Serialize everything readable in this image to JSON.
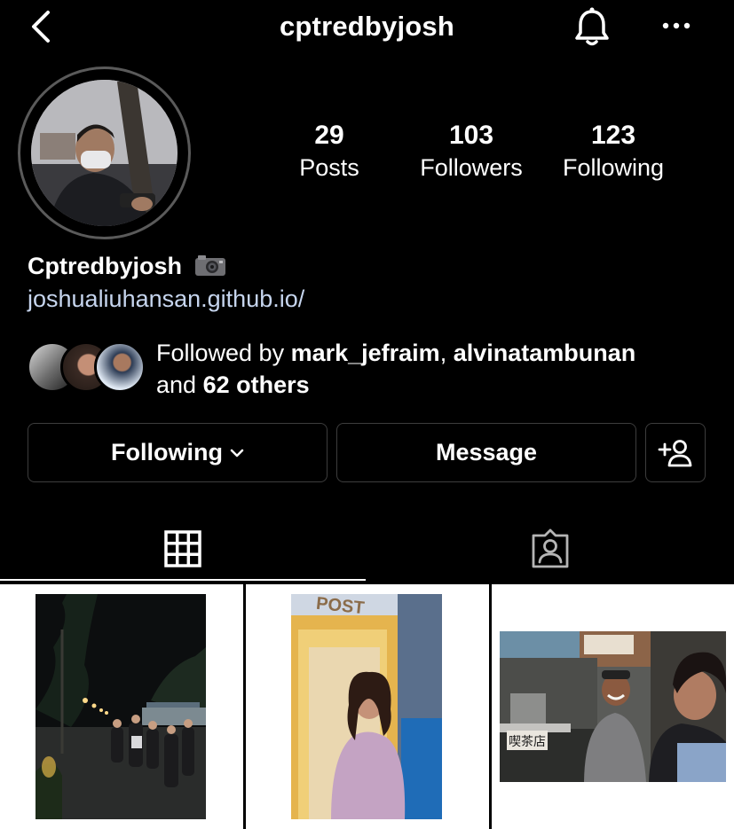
{
  "header": {
    "username": "cptredbyjosh",
    "back_icon": "chevron-left-icon",
    "bell_icon": "bell-icon",
    "more_icon": "more-horizontal-icon"
  },
  "profile": {
    "stats": [
      {
        "value": "29",
        "label": "Posts"
      },
      {
        "value": "103",
        "label": "Followers"
      },
      {
        "value": "123",
        "label": "Following"
      }
    ],
    "display_name": "Cptredbyjosh",
    "website": "joshualiuhansan.github.io/"
  },
  "followed_by": {
    "prefix": "Followed by ",
    "user1": "mark_jefraim",
    "sep": ", ",
    "user2": "alvinatambunan",
    "and": "and ",
    "others": "62 others"
  },
  "actions": {
    "following_label": "Following",
    "message_label": "Message"
  },
  "tabs": [
    {
      "icon": "grid-icon",
      "active": true
    },
    {
      "icon": "tagged-person-icon",
      "active": false
    }
  ],
  "posts": [
    {
      "text": ""
    },
    {
      "text": "POST"
    },
    {
      "text": "喫茶店"
    }
  ],
  "colors": {
    "background": "#000000",
    "link": "#c6d5ee",
    "border": "#3d3d3d"
  }
}
